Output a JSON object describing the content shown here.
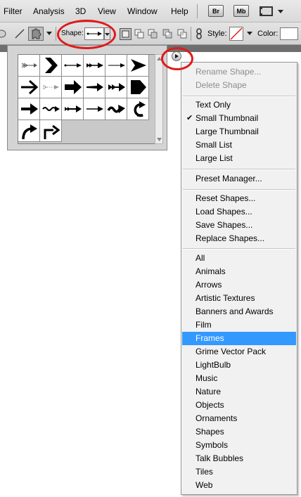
{
  "menubar": {
    "items": [
      "Filter",
      "Analysis",
      "3D",
      "View",
      "Window",
      "Help"
    ],
    "br_label": "Br",
    "mb_label": "Mb"
  },
  "options": {
    "shape_label": "Shape:",
    "style_label": "Style:",
    "color_label": "Color:"
  },
  "shape_grid": {
    "shapes": [
      "arrow-1",
      "arrow-2",
      "arrow-3",
      "arrow-4",
      "arrow-5",
      "arrow-6",
      "arrow-7",
      "arrow-8",
      "arrow-9",
      "arrow-10",
      "arrow-11",
      "arrow-12",
      "arrow-13",
      "arrow-14",
      "arrow-15",
      "arrow-16",
      "arrow-17",
      "arrow-18",
      "arrow-19",
      "arrow-20"
    ]
  },
  "context_menu": {
    "rename_shape": "Rename Shape...",
    "delete_shape": "Delete Shape",
    "text_only": "Text Only",
    "small_thumbnail": "Small Thumbnail",
    "large_thumbnail": "Large Thumbnail",
    "small_list": "Small List",
    "large_list": "Large List",
    "preset_manager": "Preset Manager...",
    "reset_shapes": "Reset Shapes...",
    "load_shapes": "Load Shapes...",
    "save_shapes": "Save Shapes...",
    "replace_shapes": "Replace Shapes...",
    "libraries": [
      "All",
      "Animals",
      "Arrows",
      "Artistic Textures",
      "Banners and Awards",
      "Film",
      "Frames",
      "Grime Vector Pack",
      "LightBulb",
      "Music",
      "Nature",
      "Objects",
      "Ornaments",
      "Shapes",
      "Symbols",
      "Talk Bubbles",
      "Tiles",
      "Web"
    ],
    "selected": "Frames"
  },
  "colors": {
    "highlight": "#3399ff",
    "annotation": "#e11a1a"
  }
}
